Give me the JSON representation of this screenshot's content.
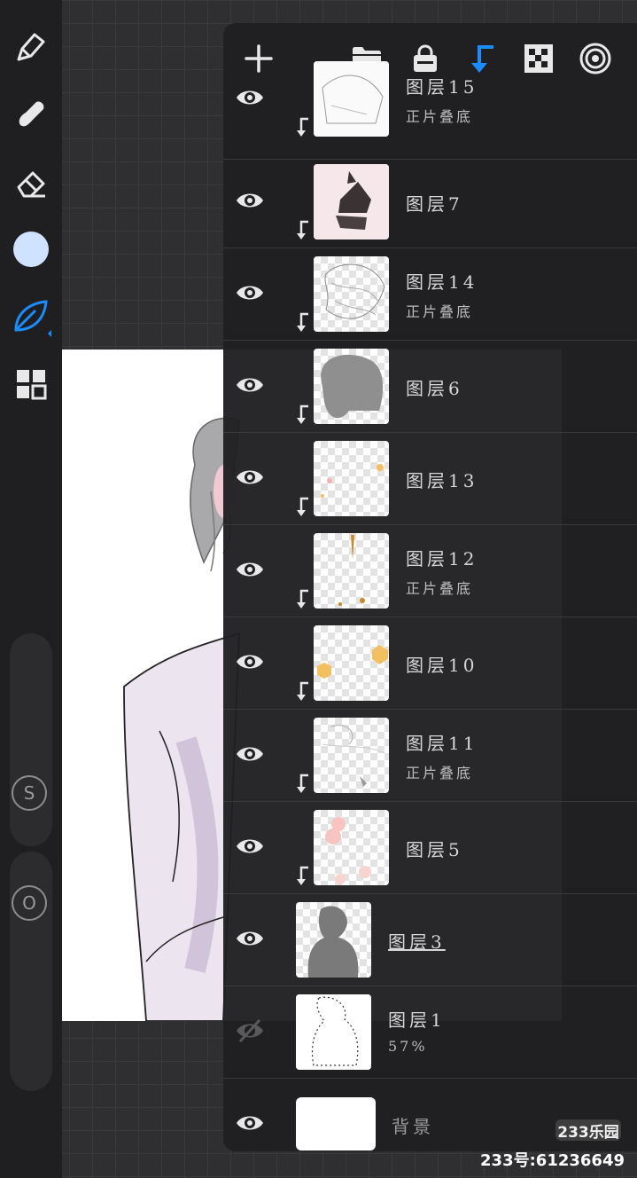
{
  "colors": {
    "accent": "#1a8cff",
    "current_color": "#cfe2ff",
    "panel_bg": "#1f1f21"
  },
  "toolbar": {
    "tools": [
      {
        "name": "brush-icon"
      },
      {
        "name": "smudge-icon"
      },
      {
        "name": "eraser-icon"
      },
      {
        "name": "color-swatch-icon"
      },
      {
        "name": "selection-leaf-icon"
      },
      {
        "name": "layers-grid-icon"
      }
    ],
    "size_button_label": "S",
    "opacity_button_label": "O"
  },
  "layers_panel": {
    "header_icons": [
      "add-layer-icon",
      "folder-icon",
      "lock-icon",
      "clip-arrow-icon",
      "checkerboard-icon",
      "target-icon"
    ],
    "layers": [
      {
        "name": "图层15",
        "mode": "正片叠底",
        "visible": true,
        "clipped": true
      },
      {
        "name": "图层7",
        "mode": "",
        "visible": true,
        "clipped": true
      },
      {
        "name": "图层14",
        "mode": "正片叠底",
        "visible": true,
        "clipped": true
      },
      {
        "name": "图层6",
        "mode": "",
        "visible": true,
        "clipped": true
      },
      {
        "name": "图层13",
        "mode": "",
        "visible": true,
        "clipped": true
      },
      {
        "name": "图层12",
        "mode": "正片叠底",
        "visible": true,
        "clipped": true
      },
      {
        "name": "图层10",
        "mode": "",
        "visible": true,
        "clipped": true
      },
      {
        "name": "图层11",
        "mode": "正片叠底",
        "visible": true,
        "clipped": true
      },
      {
        "name": "图层5",
        "mode": "",
        "visible": true,
        "clipped": true
      },
      {
        "name": "图层3",
        "mode": "",
        "visible": true,
        "clipped": false
      },
      {
        "name": "图层1",
        "mode": "57%",
        "visible": false,
        "clipped": false
      },
      {
        "name": "背景",
        "mode": "",
        "visible": true,
        "clipped": false
      }
    ]
  },
  "watermark": {
    "badge": "233乐园",
    "id_text": "233号:61236649"
  }
}
